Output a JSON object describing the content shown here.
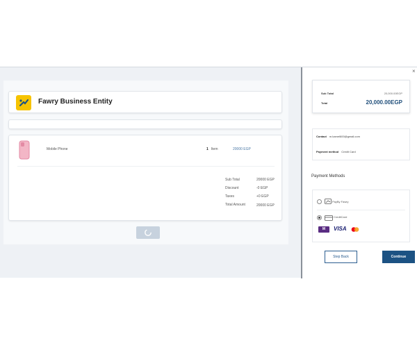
{
  "merchant": {
    "name": "Fawry Business Entity"
  },
  "order": {
    "item": {
      "name": "Mobile Phone",
      "qty": "1",
      "qty_unit": "Item",
      "price": "20000 EGP"
    },
    "summary": [
      {
        "label": "Sub Total",
        "value": "20000 EGP"
      },
      {
        "label": "Discount",
        "value": "-0 EGP"
      },
      {
        "label": "Taxes",
        "value": "+0 EGP"
      },
      {
        "label": "Total Amount",
        "value": "20000 EGP"
      }
    ]
  },
  "panel": {
    "close": "×",
    "totals": {
      "subtotal_label": "Sub Total",
      "subtotal_value": "20,000.00EGP",
      "total_label": "Total",
      "total_value": "20,000.00EGP"
    },
    "contact": {
      "contact_label": "Contact",
      "contact_value": "m.kamel600@gmail.com",
      "method_label": "Payment method",
      "method_value": "Credit Card"
    },
    "payment_methods_title": "Payment Methods",
    "options": [
      {
        "label": "PayBy Fawry",
        "selected": false
      },
      {
        "label": "CreditCard",
        "selected": true
      }
    ],
    "brands": {
      "meeza": "M",
      "visa": "VISA"
    },
    "back_label": "Step Back",
    "continue_label": "Continue"
  },
  "colors": {
    "accent": "#1c5283",
    "logo": "#f6c300"
  }
}
